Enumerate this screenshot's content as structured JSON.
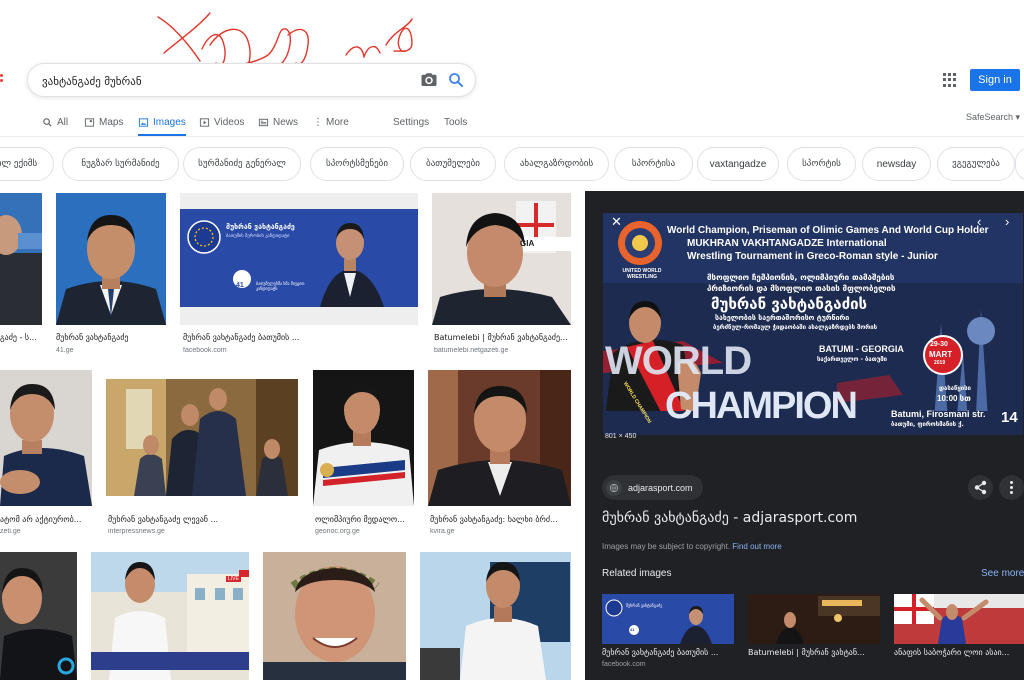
{
  "search": {
    "query": "ვახტანგაძე მუხრან"
  },
  "header": {
    "signin_label": "Sign in"
  },
  "tabs": [
    {
      "label": "All"
    },
    {
      "label": "Maps"
    },
    {
      "label": "Images"
    },
    {
      "label": "Videos"
    },
    {
      "label": "News"
    },
    {
      "label": "More"
    }
  ],
  "tools": {
    "settings_label": "Settings",
    "tools_label": "Tools",
    "safesearch_label": "SafeSearch ▾"
  },
  "chips": [
    "ილ ექიმს",
    "ნუგზარ სურმანიძე",
    "სურმანიძე გენერალ",
    "სპორტსმენები",
    "ბათუმელები",
    "ახალგაზრდობის",
    "სპორტისა",
    "vaxtangadze",
    "სპორტის",
    "newsday",
    "ვგეგულება"
  ],
  "results": [
    {
      "caption": "გაძე - ს...",
      "source": ""
    },
    {
      "caption": "მუხრან ვახტანგაძე",
      "source": "41.ge"
    },
    {
      "caption": "მუხრან ვახტანგაძე ბათუმის ...",
      "source": "facebook.com"
    },
    {
      "caption": "Batumelebi | მუხრან ვახტანგაძე...",
      "source": "batumelebi.netgazeti.ge"
    },
    {
      "caption": "ატომ არ აქტიურობ...",
      "source": "zeti.ge"
    },
    {
      "caption": "მუხრან ვახტანგაძე ლევან ...",
      "source": "interpressnews.ge"
    },
    {
      "caption": "ოლიმპიური მედალო...",
      "source": "geonoc.org.ge"
    },
    {
      "caption": "მუხრან ვახტანგაძე: ხალხი ბრძ...",
      "source": "kvira.ge"
    }
  ],
  "tile_texts": {
    "r1c3_header": "მუხრან ვახტანგაძე",
    "r1c3_sub": "ბათუმის მერობის კანდიდატი",
    "r1c3_badge": "41",
    "r1c3_footer": "ბათუმელებმა ხმა მიეცით კანდიდატს",
    "r1c4_banner": "GIA",
    "r3c2_live": "LIVE"
  },
  "panel": {
    "poster": {
      "line1": "World Champion, Priseman of Olimic Games And World Cup Holder",
      "line2": "MUKHRAN VAKHTANGADZE International",
      "line3": "Wrestling Tournament  in Greco-Roman style - Junior",
      "geo1": "მსოფლიო ჩემპიონის, ოლიმპიური თამაშების",
      "geo2": "პრიზიორის და მსოფლიო თასის მფლობელის",
      "geo_name": "მუხრან ვახტანგაძის",
      "geo3": "სახელობის საერთაშორისო ტურნირი",
      "geo4": "ბერძნულ-რომაულ ჭიდაობაში ახალგაზრდებს შორის",
      "logo_text": "UNITED WORLD WRESTLING",
      "world": "WORLD",
      "champion": "CHAMPION",
      "sash": "WORLD CHAMPION",
      "city": "BATUMI - GEORGIA",
      "city_geo": "საქართველო - ბათუმი",
      "date_days": "29-30",
      "date_month": "MART",
      "date_year": "2019",
      "start_geo": "დასაწყისი",
      "start_time": "10:00 სთ",
      "address": "Batumi,  Firosmani str.",
      "address_num": "14",
      "address_geo": "ბათუმი, ფიროსმანის ქ."
    },
    "dims": "801 × 450",
    "source_label": "adjarasport.com",
    "title": "მუხრან ვახტანგაძე - adjarasport.com",
    "copyright": "Images may be subject to copyright. ",
    "find_out_more": "Find out more",
    "related_label": "Related images",
    "see_more": "See more",
    "related": [
      {
        "caption": "მუხრან ვახტანგაძე ბათუმის ...",
        "source": "facebook.com"
      },
      {
        "caption": "Batumelebi | მუხრან ვახტან...",
        "source": ""
      },
      {
        "caption": "ანაფის საბოჭარი ლოი ასაი...",
        "source": ""
      }
    ],
    "rel1_header": "მუხრან ვახტანგაძე",
    "rel1_badge": "41"
  },
  "colors": {
    "accent": "#1a73e8",
    "panel_bg": "#202124",
    "poster_bg": "#1c2b4f",
    "scribble": "#e0382c"
  }
}
